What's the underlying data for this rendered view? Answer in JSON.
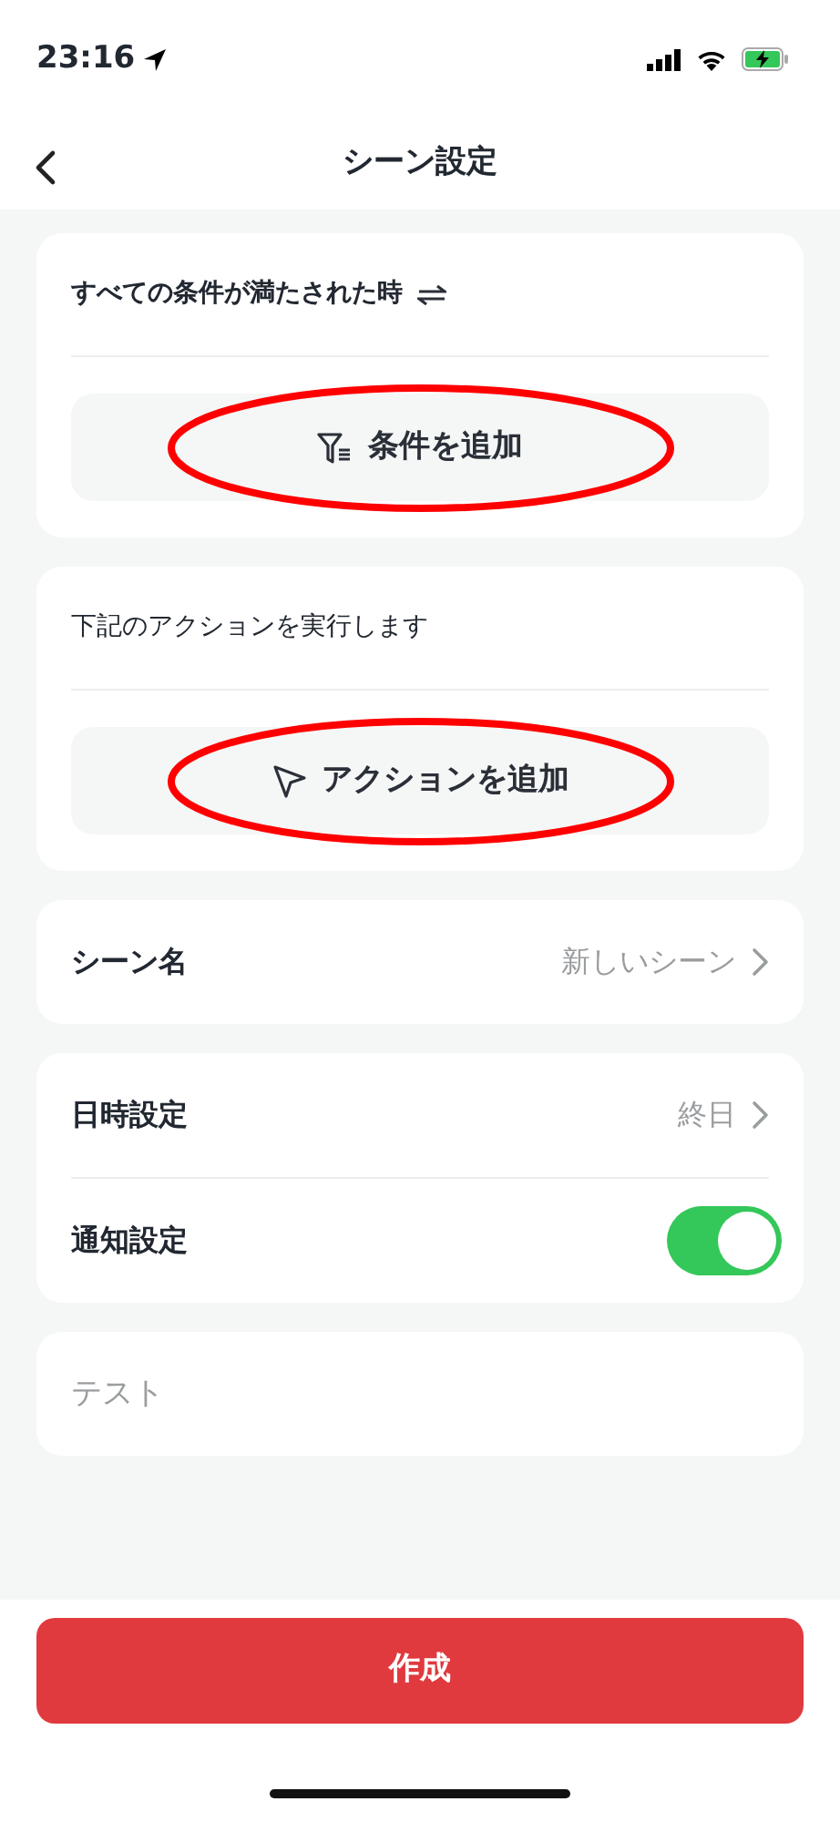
{
  "status_bar": {
    "time": "23:16"
  },
  "nav": {
    "title": "シーン設定"
  },
  "sections": [
    {
      "title": "すべての条件が満たされた時",
      "title_bold": true,
      "button": {
        "label": "条件を追加",
        "circled": true
      }
    },
    {
      "title": "下記のアクションを実行します",
      "title_bold": false,
      "button": {
        "label": "アクションを追加",
        "circled": true
      }
    }
  ],
  "settings_groups": [
    [
      {
        "kind": "link",
        "label": "シーン名",
        "value": "新しいシーン"
      }
    ],
    [
      {
        "kind": "link",
        "label": "日時設定",
        "value": "終日"
      },
      {
        "kind": "toggle",
        "label": "通知設定",
        "on": true
      }
    ]
  ],
  "note_field": {
    "placeholder": "テスト"
  },
  "submit_button": {
    "label": "作成"
  }
}
